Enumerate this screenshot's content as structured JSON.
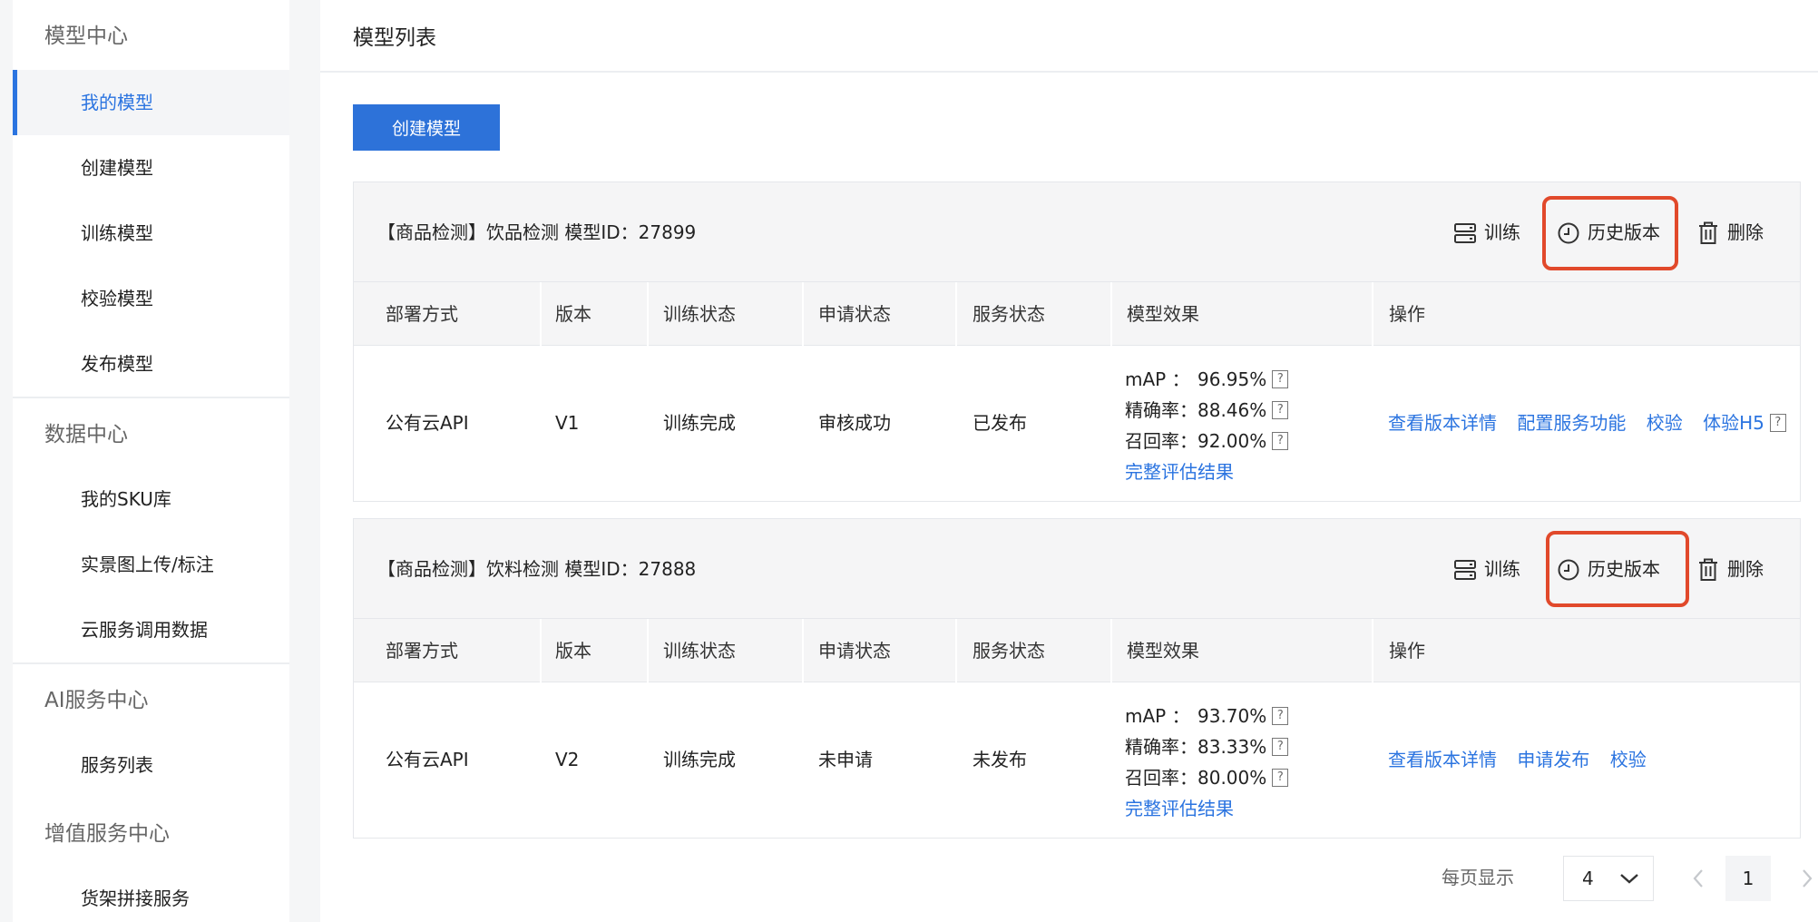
{
  "sidebar": {
    "groups": [
      {
        "title": "模型中心",
        "items": [
          "我的模型",
          "创建模型",
          "训练模型",
          "校验模型",
          "发布模型"
        ]
      },
      {
        "title": "数据中心",
        "items": [
          "我的SKU库",
          "实景图上传/标注",
          "云服务调用数据"
        ]
      },
      {
        "title": "AI服务中心",
        "items": [
          "服务列表"
        ]
      },
      {
        "title": "增值服务中心",
        "items": [
          "货架拼接服务"
        ]
      }
    ]
  },
  "header": {
    "title": "模型列表"
  },
  "toolbar": {
    "create_label": "创建模型"
  },
  "card_actions": {
    "train": "训练",
    "history": "历史版本",
    "delete": "删除"
  },
  "table_headers": [
    "部署方式",
    "版本",
    "训练状态",
    "申请状态",
    "服务状态",
    "模型效果",
    "操作"
  ],
  "metric_labels": {
    "map": "mAP ：",
    "precision": "精确率：",
    "recall": "召回率：",
    "help": "?"
  },
  "eval_link": "完整评估结果",
  "models": [
    {
      "title": "【商品检测】饮品检测 模型ID：27899",
      "deploy": "公有云API",
      "version": "V1",
      "train_status": "训练完成",
      "apply_status": "审核成功",
      "service_status": "已发布",
      "map": "96.95%",
      "precision": "88.46%",
      "recall": "92.00%",
      "ops": [
        "查看版本详情",
        "配置服务功能",
        "校验",
        "体验H5"
      ]
    },
    {
      "title": "【商品检测】饮料检测 模型ID：27888",
      "deploy": "公有云API",
      "version": "V2",
      "train_status": "训练完成",
      "apply_status": "未申请",
      "service_status": "未发布",
      "map": "93.70%",
      "precision": "83.33%",
      "recall": "80.00%",
      "ops": [
        "查看版本详情",
        "申请发布",
        "校验"
      ]
    }
  ],
  "pagination": {
    "per_page_label": "每页显示",
    "per_page_value": "4",
    "current_page": "1"
  },
  "colors": {
    "accent": "#2b74e0",
    "highlight": "#e1492b",
    "button": "#2d72d9"
  }
}
